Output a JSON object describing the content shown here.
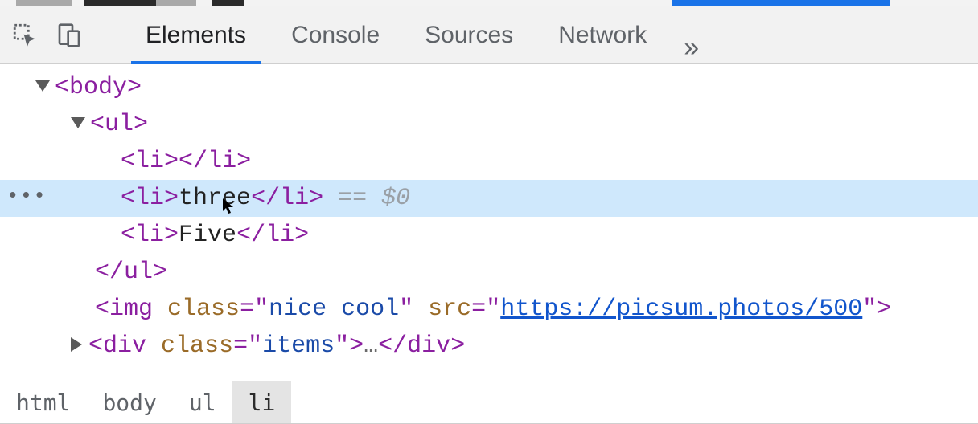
{
  "tabs": {
    "elements": "Elements",
    "console": "Console",
    "sources": "Sources",
    "network": "Network",
    "overflow": "»"
  },
  "selected_marker": "•••",
  "dom": {
    "body_open": "body",
    "ul_open": "ul",
    "li_empty": "li",
    "li_three": {
      "tag": "li",
      "text": "three",
      "marker": " == $0"
    },
    "li_five": {
      "tag": "li",
      "text": "Five"
    },
    "ul_close": "ul",
    "img": {
      "tag": "img",
      "class_attr": "class",
      "class_val": "nice cool",
      "src_attr": "src",
      "src_val": "https://picsum.photos/500"
    },
    "div": {
      "tag": "div",
      "class_attr": "class",
      "class_val": "items",
      "ellipsis": "…"
    }
  },
  "breadcrumbs": [
    "html",
    "body",
    "ul",
    "li"
  ]
}
